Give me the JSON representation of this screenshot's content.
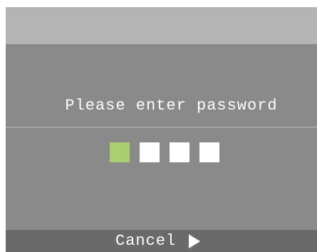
{
  "prompt": {
    "text": "Please enter password"
  },
  "pin": {
    "length": 4,
    "active_index": 0,
    "active_color": "#a9cf6e",
    "empty_color": "#ffffff"
  },
  "footer": {
    "cancel_label": "Cancel",
    "cancel_icon": "play-arrow-icon"
  },
  "colors": {
    "screen_background": "#8a8a8a",
    "title_bar": "#b4b4b4",
    "footer_bar": "#6a6a6a"
  }
}
